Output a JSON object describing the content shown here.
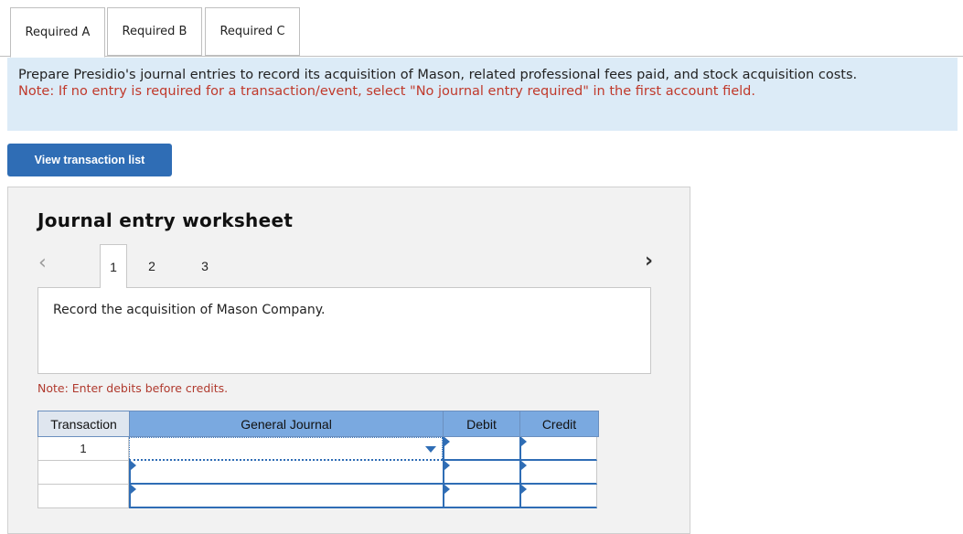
{
  "tabs": [
    {
      "label": "Required A",
      "active": true
    },
    {
      "label": "Required B",
      "active": false
    },
    {
      "label": "Required C",
      "active": false
    }
  ],
  "instructions": {
    "main": "Prepare Presidio's journal entries to record its acquisition of Mason, related professional fees paid, and stock acquisition costs.",
    "note": "Note: If no entry is required for a transaction/event, select \"No journal entry required\" in the first account field."
  },
  "buttons": {
    "view_transactions": "View transaction list"
  },
  "worksheet": {
    "title": "Journal entry worksheet",
    "pages": [
      "1",
      "2",
      "3"
    ],
    "active_page": "1",
    "description": "Record the acquisition of Mason Company.",
    "note": "Note: Enter debits before credits.",
    "table": {
      "headers": {
        "transaction": "Transaction",
        "general_journal": "General Journal",
        "debit": "Debit",
        "credit": "Credit"
      },
      "rows": [
        {
          "transaction": "1",
          "account": "",
          "debit": "",
          "credit": ""
        },
        {
          "transaction": "",
          "account": "",
          "debit": "",
          "credit": ""
        },
        {
          "transaction": "",
          "account": "",
          "debit": "",
          "credit": ""
        }
      ]
    }
  },
  "colors": {
    "accent": "#2f6db5",
    "instructions_bg": "#dcebf7",
    "note_red": "#c0392b",
    "table_header": "#7aa9e0"
  }
}
